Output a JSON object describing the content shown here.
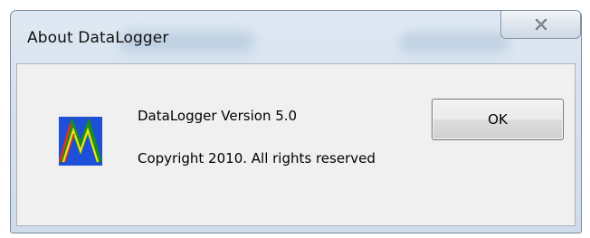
{
  "window": {
    "title": "About DataLogger"
  },
  "content": {
    "version_text": "DataLogger Version 5.0",
    "copyright_text": "Copyright 2010. All rights reserved"
  },
  "buttons": {
    "ok_label": "OK"
  },
  "icons": {
    "app": "datalogger-m-logo",
    "close": "close-x"
  }
}
